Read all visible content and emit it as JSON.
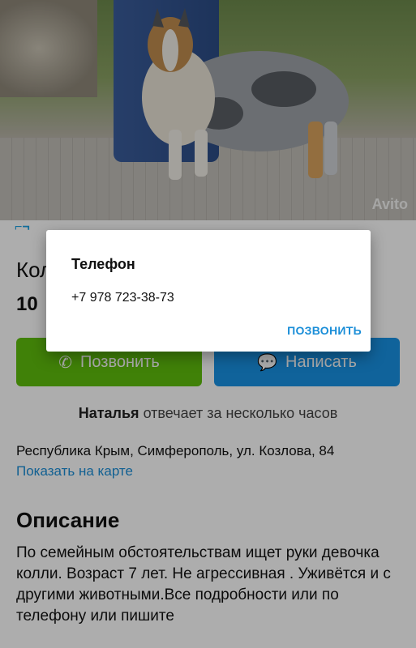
{
  "photo": {
    "watermark": "Avito"
  },
  "listing": {
    "title": "Колли",
    "price": "10",
    "call_button": "Позвонить",
    "message_button": "Написать",
    "seller_name": "Наталья",
    "seller_status": "отвечает за несколько часов",
    "address": "Республика Крым, Симферополь, ул. Козлова, 84",
    "map_link": "Показать на карте",
    "description_heading": "Описание",
    "description": "По семейным обстоятельствам ищет руки девочка колли. Возраст 7 лет. Не агрессивная . Уживётся и с другими животными.Все подробности или по телефону или пишите"
  },
  "dialog": {
    "title": "Телефон",
    "phone": "+7 978 723-38-73",
    "action": "ПОЗВОНИТЬ"
  },
  "colors": {
    "call_green": "#5fbf0c",
    "message_blue": "#1992e5",
    "link_blue": "#1a8ed8"
  }
}
